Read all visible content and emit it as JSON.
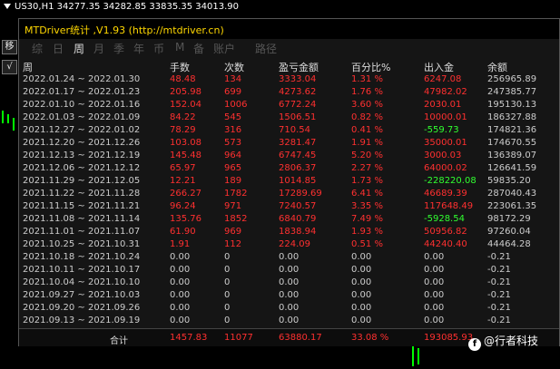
{
  "chart": {
    "symbol_line": "US30,H1  34277.35 34282.85 33835.35 34013.90",
    "side_buttons": [
      "移",
      "√"
    ]
  },
  "panel": {
    "title": "MTDriver统计 ,V1.93 (http://mtdriver.cn)",
    "tabs": [
      {
        "label": "综",
        "active": false
      },
      {
        "label": "日",
        "active": false
      },
      {
        "label": "周",
        "active": true
      },
      {
        "label": "月",
        "active": false
      },
      {
        "label": "季",
        "active": false
      },
      {
        "label": "年",
        "active": false
      },
      {
        "label": "币",
        "active": false
      },
      {
        "label": "M",
        "active": false
      },
      {
        "label": "备",
        "active": false
      },
      {
        "label": "账户",
        "active": false
      },
      {
        "label": "路径",
        "active": false
      }
    ],
    "columns": [
      "周",
      "手数",
      "次数",
      "盈亏金额",
      "百分比%",
      "出入金",
      "余额"
    ],
    "rows": [
      {
        "week": "2022.01.24 ~ 2022.01.30",
        "hands": "48.48",
        "count": "134",
        "pl": "3333.04",
        "pct": "1.31 %",
        "flow": "6247.08",
        "flow_color": "red",
        "balance": "256965.89"
      },
      {
        "week": "2022.01.17 ~ 2022.01.23",
        "hands": "205.98",
        "count": "699",
        "pl": "4273.62",
        "pct": "1.76 %",
        "flow": "47982.02",
        "flow_color": "red",
        "balance": "247385.77"
      },
      {
        "week": "2022.01.10 ~ 2022.01.16",
        "hands": "152.04",
        "count": "1006",
        "pl": "6772.24",
        "pct": "3.60 %",
        "flow": "2030.01",
        "flow_color": "red",
        "balance": "195130.13"
      },
      {
        "week": "2022.01.03 ~ 2022.01.09",
        "hands": "84.22",
        "count": "545",
        "pl": "1506.51",
        "pct": "0.82 %",
        "flow": "10000.01",
        "flow_color": "red",
        "balance": "186327.88"
      },
      {
        "week": "2021.12.27 ~ 2022.01.02",
        "hands": "78.29",
        "count": "316",
        "pl": "710.54",
        "pct": "0.41 %",
        "flow": "-559.73",
        "flow_color": "green",
        "balance": "174821.36"
      },
      {
        "week": "2021.12.20 ~ 2021.12.26",
        "hands": "103.08",
        "count": "573",
        "pl": "3281.47",
        "pct": "1.91 %",
        "flow": "35000.01",
        "flow_color": "red",
        "balance": "174670.55"
      },
      {
        "week": "2021.12.13 ~ 2021.12.19",
        "hands": "145.48",
        "count": "964",
        "pl": "6747.45",
        "pct": "5.20 %",
        "flow": "3000.03",
        "flow_color": "red",
        "balance": "136389.07"
      },
      {
        "week": "2021.12.06 ~ 2021.12.12",
        "hands": "65.97",
        "count": "965",
        "pl": "2806.37",
        "pct": "2.27 %",
        "flow": "64000.02",
        "flow_color": "red",
        "balance": "126641.59"
      },
      {
        "week": "2021.11.29 ~ 2021.12.05",
        "hands": "12.21",
        "count": "189",
        "pl": "1014.85",
        "pct": "1.73 %",
        "flow": "-228220.08",
        "flow_color": "green",
        "balance": "59835.20"
      },
      {
        "week": "2021.11.22 ~ 2021.11.28",
        "hands": "266.27",
        "count": "1782",
        "pl": "17289.69",
        "pct": "6.41 %",
        "flow": "46689.39",
        "flow_color": "red",
        "balance": "287040.43"
      },
      {
        "week": "2021.11.15 ~ 2021.11.21",
        "hands": "96.24",
        "count": "971",
        "pl": "7240.57",
        "pct": "3.35 %",
        "flow": "117648.49",
        "flow_color": "red",
        "balance": "223061.35"
      },
      {
        "week": "2021.11.08 ~ 2021.11.14",
        "hands": "135.76",
        "count": "1852",
        "pl": "6840.79",
        "pct": "7.49 %",
        "flow": "-5928.54",
        "flow_color": "green",
        "balance": "98172.29"
      },
      {
        "week": "2021.11.01 ~ 2021.11.07",
        "hands": "61.90",
        "count": "969",
        "pl": "1838.94",
        "pct": "1.93 %",
        "flow": "50956.82",
        "flow_color": "red",
        "balance": "97260.04"
      },
      {
        "week": "2021.10.25 ~ 2021.10.31",
        "hands": "1.91",
        "count": "112",
        "pl": "224.09",
        "pct": "0.51 %",
        "flow": "44240.40",
        "flow_color": "red",
        "balance": "44464.28"
      },
      {
        "week": "2021.10.18 ~ 2021.10.24",
        "hands": "0.00",
        "count": "0",
        "pl": "0.00",
        "pct": "0.00",
        "flow": "0.00",
        "flow_color": "gray",
        "balance": "-0.21"
      },
      {
        "week": "2021.10.11 ~ 2021.10.17",
        "hands": "0.00",
        "count": "0",
        "pl": "0.00",
        "pct": "0.00",
        "flow": "0.00",
        "flow_color": "gray",
        "balance": "-0.21"
      },
      {
        "week": "2021.10.04 ~ 2021.10.10",
        "hands": "0.00",
        "count": "0",
        "pl": "0.00",
        "pct": "0.00",
        "flow": "0.00",
        "flow_color": "gray",
        "balance": "-0.21"
      },
      {
        "week": "2021.09.27 ~ 2021.10.03",
        "hands": "0.00",
        "count": "0",
        "pl": "0.00",
        "pct": "0.00",
        "flow": "0.00",
        "flow_color": "gray",
        "balance": "-0.21"
      },
      {
        "week": "2021.09.20 ~ 2021.09.26",
        "hands": "0.00",
        "count": "0",
        "pl": "0.00",
        "pct": "0.00",
        "flow": "0.00",
        "flow_color": "gray",
        "balance": "-0.21"
      },
      {
        "week": "2021.09.13 ~ 2021.09.19",
        "hands": "0.00",
        "count": "0",
        "pl": "0.00",
        "pct": "0.00",
        "flow": "0.00",
        "flow_color": "gray",
        "balance": "-0.21"
      }
    ],
    "total": {
      "label": "合计",
      "hands": "1457.83",
      "count": "11077",
      "pl": "63880.17",
      "pct": "33.08 %",
      "flow": "193085.93"
    }
  },
  "watermark": {
    "logo": "f",
    "text": "@行者科技"
  },
  "colors": {
    "red": "#ff3030",
    "green": "#30ff30",
    "gray": "#cccccc",
    "title": "#ffd700"
  }
}
